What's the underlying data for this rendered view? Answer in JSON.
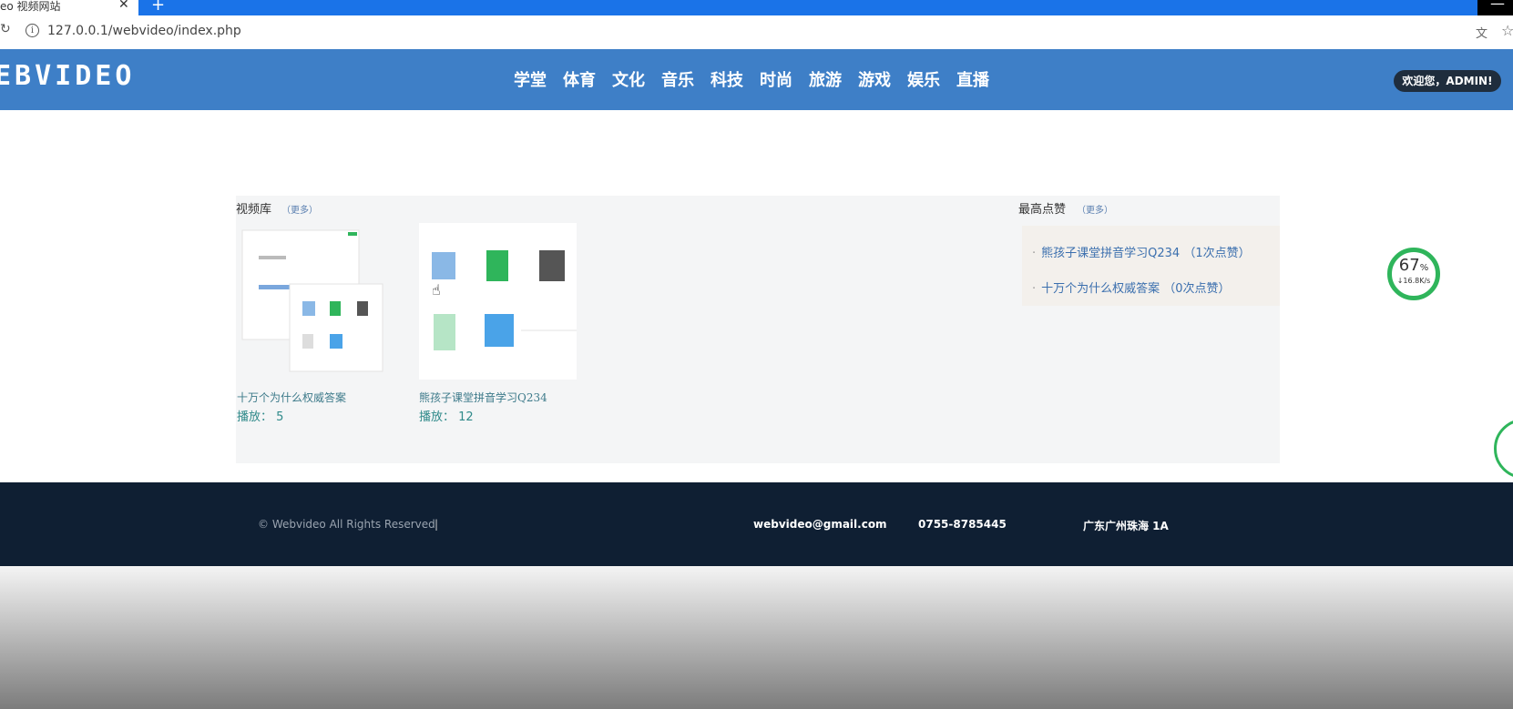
{
  "browser": {
    "tab_title": "eo 视频网站",
    "url": "127.0.0.1/webvideo/index.php"
  },
  "site": {
    "logo": "EBVIDEO",
    "nav": [
      "学堂",
      "体育",
      "文化",
      "音乐",
      "科技",
      "时尚",
      "旅游",
      "游戏",
      "娱乐",
      "直播"
    ],
    "user_greeting": "欢迎您，ADMIN!"
  },
  "library": {
    "title": "视频库",
    "more": "（更多）",
    "videos": [
      {
        "title": "十万个为什么权威答案",
        "play_label": "播放：",
        "plays": "5"
      },
      {
        "title": "熊孩子课堂拼音学习Q234",
        "play_label": "播放：",
        "plays": "12"
      }
    ]
  },
  "top_liked": {
    "title": "最高点赞",
    "more": "（更多）",
    "items": [
      {
        "text": "熊孩子课堂拼音学习Q234 （1次点赞）"
      },
      {
        "text": "十万个为什么权威答案 （0次点赞）"
      }
    ]
  },
  "speed_widget": {
    "percent": "67",
    "unit": "%",
    "rate": "↓16.8K/s"
  },
  "footer": {
    "copyright": "© Webvideo All Rights Reserved",
    "separator": "|",
    "email": "webvideo@gmail.com",
    "phone": "0755-8785445",
    "address": "广东广州珠海 1A"
  }
}
